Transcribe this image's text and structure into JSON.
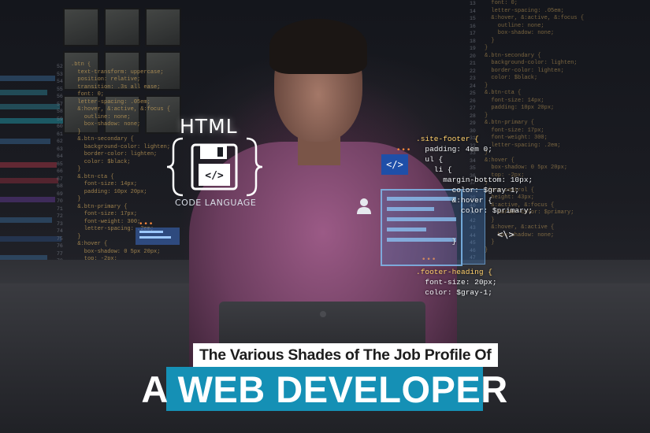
{
  "graphic": {
    "html_label": "HTML",
    "code_language": "CODE LANGUAGE",
    "tag_symbol": "</>",
    "chevrons": "<\\>"
  },
  "footer_code": {
    "lines": [
      ".site-footer {",
      "  padding: 4em 0;",
      "  ul {",
      "    li {",
      "      margin-bottom: 10px;",
      "        color: $gray-1;",
      "        &:hover {",
      "          color: $primary;",
      "",
      "",
      "        }",
      "",
      "",
      ".footer-heading {",
      "  font-size: 20px;",
      "  color: $gray-1;"
    ]
  },
  "title": {
    "subtitle": "The Various Shades of The Job Profile Of",
    "headline": "A WEB DEVELOPER"
  },
  "colors": {
    "headline_bg": "#1590b5",
    "subtitle_bg": "#ffffff",
    "shirt": "#8b4f78"
  },
  "icons": [
    "floppy-disk-icon",
    "code-tag-icon",
    "user-icon"
  ]
}
